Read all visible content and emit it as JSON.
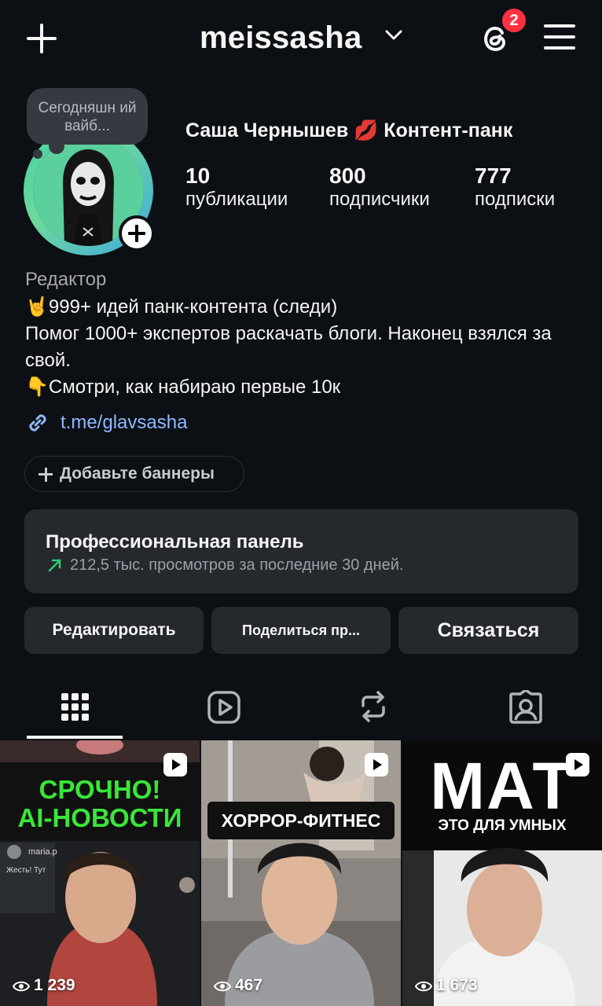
{
  "header": {
    "username": "meissasha",
    "notification_count": "2"
  },
  "profile": {
    "note": "Сегодняшн ий вайб...",
    "full_name": "Саша Чернышев 💋 Контент-панк",
    "stats": [
      {
        "value": "10",
        "label": "публикации"
      },
      {
        "value": "800",
        "label": "подписчики"
      },
      {
        "value": "777",
        "label": "подписки"
      }
    ],
    "category": "Редактор",
    "bio_lines": [
      "🤘999+ идей панк-контента (следи)",
      "Помог 1000+ экспертов раскачать блоги. Наконец взялся за свой.",
      "👇Смотри, как набираю первые 10к"
    ],
    "link": "t.me/glavsasha"
  },
  "banner_button": "Добавьте баннеры",
  "pro_panel": {
    "title": "Профессиональная панель",
    "subtitle": "212,5 тыс. просмотров за последние 30 дней."
  },
  "actions": {
    "edit": "Редактировать",
    "share": "Поделиться пр...",
    "contact": "Связаться"
  },
  "tabs": [
    "grid",
    "reels",
    "reposts",
    "tagged"
  ],
  "posts": [
    {
      "headline_1": "СРОЧНО!",
      "headline_2": "AI-НОВОСТИ",
      "views": "1 239",
      "overlay_user": "maria.p",
      "overlay_text": "Жесть! Тут"
    },
    {
      "headline_1": "ХОРРОР-ФИТНЕС",
      "views": "467"
    },
    {
      "headline_1": "МАТ",
      "headline_2": "ЭТО ДЛЯ УМНЫХ",
      "views": "1 673"
    }
  ],
  "colors": {
    "background": "#0c1014",
    "surface": "#25292e",
    "badge": "#ff3040",
    "link": "#8fb8ff",
    "headline_green": "#39e639"
  }
}
